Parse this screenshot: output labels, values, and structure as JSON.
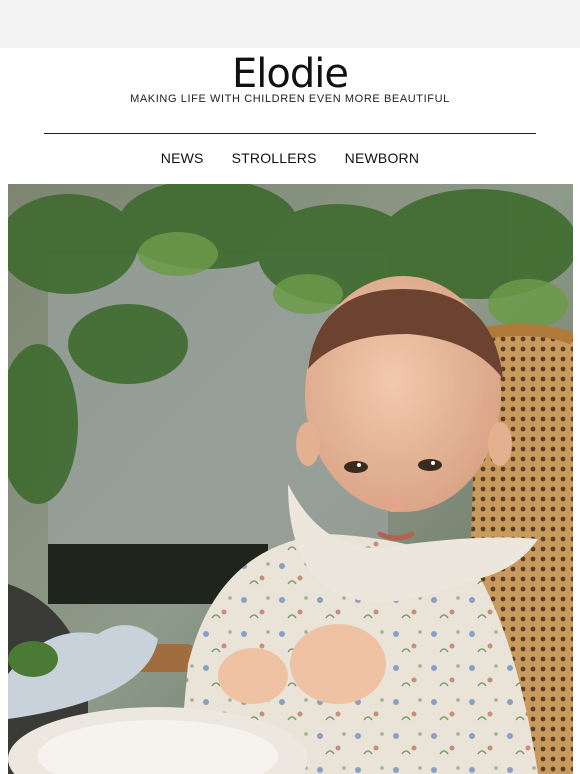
{
  "brand": {
    "logo_text": "Elodie",
    "tagline": "MAKING LIFE WITH CHILDREN EVEN MORE BEAUTIFUL"
  },
  "nav": {
    "items": [
      {
        "label": "NEWS"
      },
      {
        "label": "STROLLERS"
      },
      {
        "label": "NEWBORN"
      }
    ]
  },
  "colors": {
    "page_background": "#f4f4f4",
    "card_background": "#ffffff",
    "text": "#111111"
  }
}
